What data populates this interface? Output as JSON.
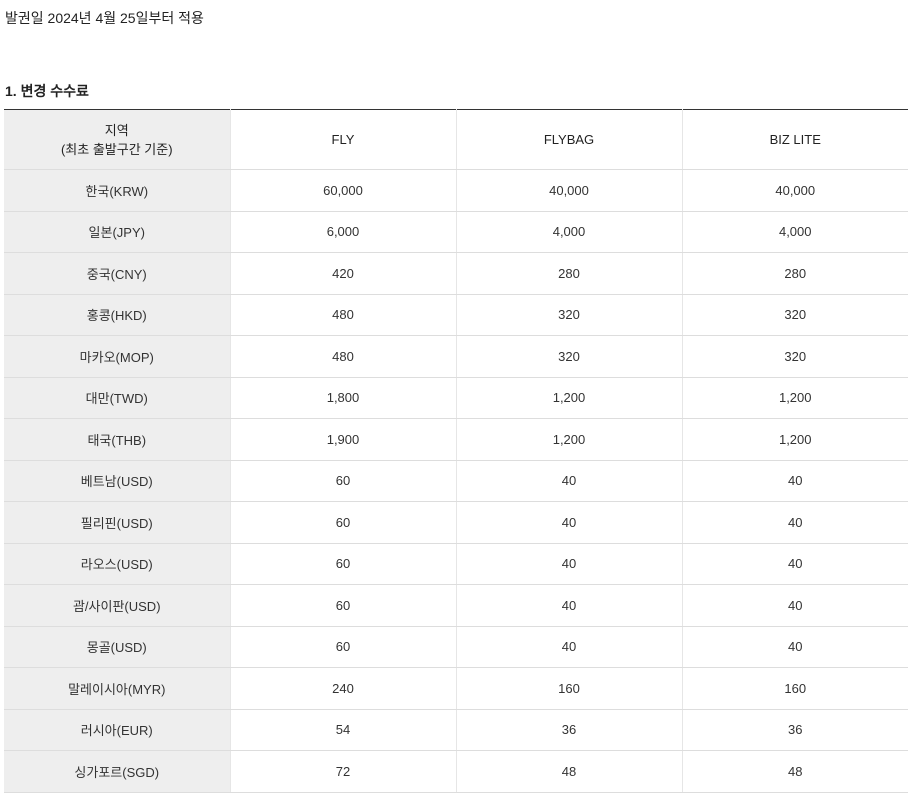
{
  "notice": {
    "effective_date": "발권일 2024년 4월 25일부터 적용"
  },
  "section": {
    "title": "1. 변경 수수료"
  },
  "table": {
    "headers": {
      "region_line1": "지역",
      "region_line2": "(최초 출발구간 기준)",
      "plans": [
        "FLY",
        "FLYBAG",
        "BIZ LITE"
      ]
    },
    "rows": [
      {
        "region": "한국(KRW)",
        "fly": "60,000",
        "flybag": "40,000",
        "biz_lite": "40,000"
      },
      {
        "region": "일본(JPY)",
        "fly": "6,000",
        "flybag": "4,000",
        "biz_lite": "4,000"
      },
      {
        "region": "중국(CNY)",
        "fly": "420",
        "flybag": "280",
        "biz_lite": "280"
      },
      {
        "region": "홍콩(HKD)",
        "fly": "480",
        "flybag": "320",
        "biz_lite": "320"
      },
      {
        "region": "마카오(MOP)",
        "fly": "480",
        "flybag": "320",
        "biz_lite": "320"
      },
      {
        "region": "대만(TWD)",
        "fly": "1,800",
        "flybag": "1,200",
        "biz_lite": "1,200"
      },
      {
        "region": "태국(THB)",
        "fly": "1,900",
        "flybag": "1,200",
        "biz_lite": "1,200"
      },
      {
        "region": "베트남(USD)",
        "fly": "60",
        "flybag": "40",
        "biz_lite": "40"
      },
      {
        "region": "필리핀(USD)",
        "fly": "60",
        "flybag": "40",
        "biz_lite": "40"
      },
      {
        "region": "라오스(USD)",
        "fly": "60",
        "flybag": "40",
        "biz_lite": "40"
      },
      {
        "region": "괌/사이판(USD)",
        "fly": "60",
        "flybag": "40",
        "biz_lite": "40"
      },
      {
        "region": "몽골(USD)",
        "fly": "60",
        "flybag": "40",
        "biz_lite": "40"
      },
      {
        "region": "말레이시아(MYR)",
        "fly": "240",
        "flybag": "160",
        "biz_lite": "160"
      },
      {
        "region": "러시아(EUR)",
        "fly": "54",
        "flybag": "36",
        "biz_lite": "36"
      },
      {
        "region": "싱가포르(SGD)",
        "fly": "72",
        "flybag": "48",
        "biz_lite": "48"
      }
    ]
  },
  "colors": {
    "header_bg": "#eeeeee",
    "border_top": "#333333",
    "row_border": "#dddddd"
  }
}
